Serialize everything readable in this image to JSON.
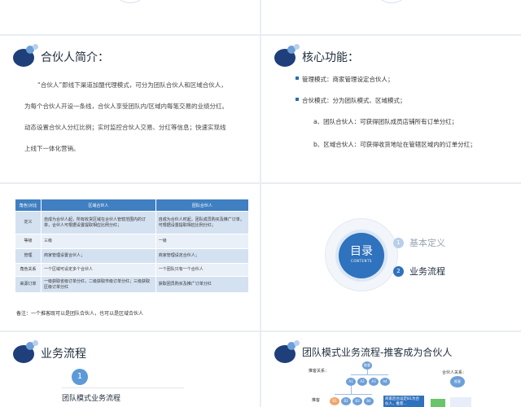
{
  "intro": {
    "title": "合伙人简介：",
    "paragraphs": [
      "“合伙人”即线下渠道加盟代理模式，可分为团队合伙人和区域合伙人，",
      "为每个合伙人开设一条线，合伙人享受团队内/区域内每笔交易的业绩分红。",
      "动态设置合伙人分红比例；实时监控合伙人交易、分红等信息；快速实现线",
      "上线下一体化营销。"
    ]
  },
  "core": {
    "title": "核心功能：",
    "items": [
      "管理模式：商家管理设定合伙人；",
      "合伙模式：分为团队模式、区域模式；"
    ],
    "subitems": [
      "a、团队合伙人：可获得团队成员店铺所有订单分红；",
      "b、区域合伙人：可获得收货地址在管辖区域内的订单分红；"
    ]
  },
  "compare": {
    "headers": [
      "角色\\对比",
      "区域合伙人",
      "团队合伙人"
    ],
    "rows": [
      [
        "定义",
        "自成为合伙人起，所有收货区域在合伙人管辖范围内的订单，合伙人可根据设置提取相应比例分红；",
        "自成为合伙人时起，团队成员购买及推广订单，可根据设置提取相应比例分红；"
      ],
      [
        "等级",
        "三级",
        "一级"
      ],
      [
        "管理",
        "商家管理设置合伙人；",
        "商家管理设定合伙人；"
      ],
      [
        "角色关系",
        "一个区域可设定多个合伙人",
        "一个团队只有一个合伙人"
      ],
      [
        "来源订单",
        "一级获取省级订单分红，二级获取市级订单分红；三级获取区级订单分红",
        "获取团员购买及推广订单分红"
      ]
    ],
    "note": "备注：一个推客既可以是团队合伙人，也可以是区域合伙人"
  },
  "toc": {
    "title": "目录",
    "subtitle": "CONTENTS",
    "items": [
      {
        "num": "1",
        "label": "基本定义"
      },
      {
        "num": "2",
        "label": "业务流程"
      }
    ]
  },
  "process": {
    "title": "业务流程",
    "step_num": "1",
    "step_title": "团队模式业务流程"
  },
  "team_flow": {
    "title": "团队模式业务流程-推客成为合伙人",
    "label_left": "推客关系：",
    "label_right": "合伙人关系：",
    "root_node": "推客",
    "level1_nodes": [
      "A1",
      "A2",
      "A3",
      "A4"
    ],
    "level2_nodes": [
      "B1",
      "B2",
      "B3",
      "B4"
    ],
    "side_label": "推客",
    "box_text": "商家后台设定B1为合伙人，推客...",
    "partner_node": "推客"
  },
  "colors": {
    "accent": "#2f72bd",
    "dark_blue": "#1e3f7a",
    "table_header": "#3f7fc2"
  }
}
